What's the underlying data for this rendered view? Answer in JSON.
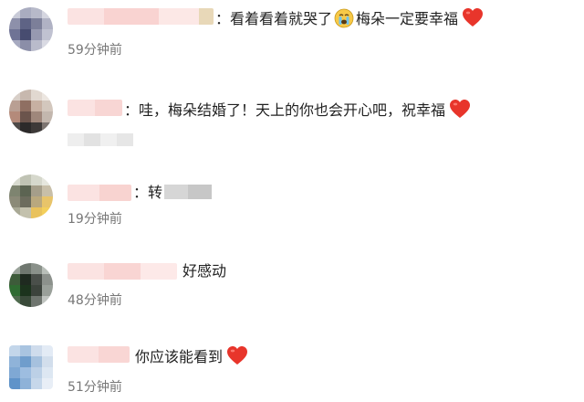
{
  "comments": [
    {
      "text_before": "：看着看着就哭了",
      "emoji_mid": "crying-face-icon",
      "text_after": "梅朵一定要幸福",
      "end_icon": "heart-icon",
      "time": "59分钟前"
    },
    {
      "text_before": "：哇，梅朵结婚了！天上的你也会开心吧，祝幸福",
      "end_icon": "heart-icon",
      "time": ""
    },
    {
      "text_before": "：转",
      "time": "19分钟前"
    },
    {
      "text_before": "好感动",
      "time": "48分钟前"
    },
    {
      "text_before": "你应该能看到",
      "end_icon": "heart-icon",
      "time": "51分钟前"
    }
  ],
  "colors": {
    "heart": "#e8352b",
    "emoji_face": "#f7c948",
    "text": "#222222",
    "time": "#777777",
    "redacted_name": "#f7c9c7"
  }
}
